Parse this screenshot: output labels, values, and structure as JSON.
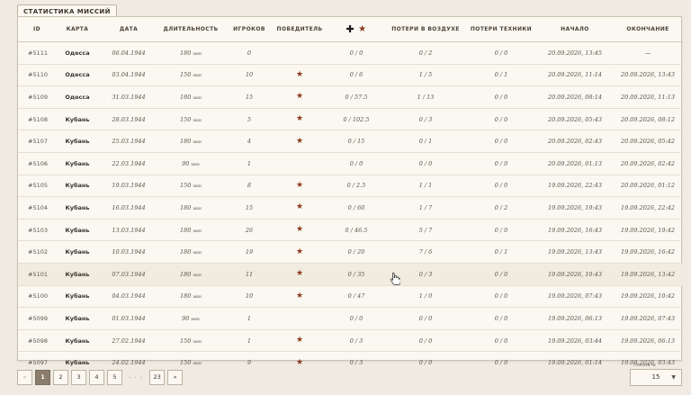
{
  "tab_title": "СТАТИСТИКА МИССИЙ",
  "columns": {
    "id": "ID",
    "map": "КАРТА",
    "date": "ДАТА",
    "duration": "ДЛИТЕЛЬНОСТЬ",
    "players": "ИГРОКОВ",
    "winner": "ПОБЕДИТЕЛЬ",
    "losses": "ПОТЕРИ В ВОЗДУХЕ",
    "tech": "ПОТЕРИ ТЕХНИКИ",
    "start": "НАЧАЛО",
    "end": "ОКОНЧАНИЕ"
  },
  "duration_unit": "мин",
  "rows": [
    {
      "id": "#5111",
      "map": "Одесса",
      "date": "06.04.1944",
      "dur": "180",
      "players": "0",
      "winner": false,
      "score": "0 / 0",
      "air": "0 / 2",
      "tech": "0 / 0",
      "start": "20.09.2026, 13:45",
      "end": "—"
    },
    {
      "id": "#5110",
      "map": "Одесса",
      "date": "03.04.1944",
      "dur": "150",
      "players": "10",
      "winner": true,
      "score": "0 / 6",
      "air": "1 / 5",
      "tech": "0 / 1",
      "start": "20.09.2026, 11:14",
      "end": "20.09.2026, 13:43"
    },
    {
      "id": "#5109",
      "map": "Одесса",
      "date": "31.03.1944",
      "dur": "180",
      "players": "15",
      "winner": true,
      "score": "0 / 57.5",
      "air": "1 / 13",
      "tech": "0 / 0",
      "start": "20.09.2026, 08:14",
      "end": "20.09.2026, 11:13"
    },
    {
      "id": "#5108",
      "map": "Кубань",
      "date": "28.03.1944",
      "dur": "150",
      "players": "5",
      "winner": true,
      "score": "0 / 102.5",
      "air": "0 / 3",
      "tech": "0 / 0",
      "start": "20.09.2026, 05:43",
      "end": "20.09.2026, 08:12"
    },
    {
      "id": "#5107",
      "map": "Кубань",
      "date": "25.03.1944",
      "dur": "180",
      "players": "4",
      "winner": true,
      "score": "0 / 15",
      "air": "0 / 1",
      "tech": "0 / 0",
      "start": "20.09.2026, 02:43",
      "end": "20.09.2026, 05:42"
    },
    {
      "id": "#5106",
      "map": "Кубань",
      "date": "22.03.1944",
      "dur": "90",
      "players": "1",
      "winner": false,
      "score": "0 / 0",
      "air": "0 / 0",
      "tech": "0 / 0",
      "start": "20.09.2026, 01:13",
      "end": "20.09.2026, 02:42"
    },
    {
      "id": "#5105",
      "map": "Кубань",
      "date": "19.03.1944",
      "dur": "150",
      "players": "8",
      "winner": true,
      "score": "0 / 2.5",
      "air": "1 / 1",
      "tech": "0 / 0",
      "start": "19.09.2026, 22:43",
      "end": "20.09.2026, 01:12"
    },
    {
      "id": "#5104",
      "map": "Кубань",
      "date": "16.03.1944",
      "dur": "180",
      "players": "15",
      "winner": true,
      "score": "0 / 60",
      "air": "1 / 7",
      "tech": "0 / 2",
      "start": "19.09.2026, 19:43",
      "end": "19.09.2026, 22:42"
    },
    {
      "id": "#5103",
      "map": "Кубань",
      "date": "13.03.1944",
      "dur": "180",
      "players": "26",
      "winner": true,
      "score": "0 / 46.5",
      "air": "5 / 7",
      "tech": "0 / 0",
      "start": "19.09.2026, 16:43",
      "end": "19.09.2026, 19:42"
    },
    {
      "id": "#5102",
      "map": "Кубань",
      "date": "10.03.1944",
      "dur": "180",
      "players": "19",
      "winner": true,
      "score": "0 / 20",
      "air": "7 / 6",
      "tech": "0 / 1",
      "start": "19.09.2026, 13:43",
      "end": "19.09.2026, 16:42"
    },
    {
      "id": "#5101",
      "map": "Кубань",
      "date": "07.03.1944",
      "dur": "180",
      "players": "11",
      "winner": true,
      "score": "0 / 35",
      "air": "0 / 3",
      "tech": "0 / 0",
      "start": "19.09.2026, 10:43",
      "end": "19.09.2026, 13:42",
      "highlight": true
    },
    {
      "id": "#5100",
      "map": "Кубань",
      "date": "04.03.1944",
      "dur": "180",
      "players": "10",
      "winner": true,
      "score": "0 / 47",
      "air": "1 / 0",
      "tech": "0 / 0",
      "start": "19.09.2026, 07:43",
      "end": "19.09.2026, 10:42"
    },
    {
      "id": "#5099",
      "map": "Кубань",
      "date": "01.03.1944",
      "dur": "90",
      "players": "1",
      "winner": false,
      "score": "0 / 0",
      "air": "0 / 0",
      "tech": "0 / 0",
      "start": "19.09.2026, 06:13",
      "end": "19.09.2026, 07:43"
    },
    {
      "id": "#5098",
      "map": "Кубань",
      "date": "27.02.1944",
      "dur": "150",
      "players": "1",
      "winner": true,
      "score": "0 / 3",
      "air": "0 / 0",
      "tech": "0 / 0",
      "start": "19.09.2026, 03:44",
      "end": "19.09.2026, 06:13"
    },
    {
      "id": "#5097",
      "map": "Кубань",
      "date": "24.02.1944",
      "dur": "150",
      "players": "9",
      "winner": true,
      "score": "0 / 3",
      "air": "0 / 0",
      "tech": "0 / 0",
      "start": "19.09.2026, 01:14",
      "end": "19.09.2026, 03:43"
    }
  ],
  "pagination": {
    "prev": "«",
    "pages": [
      "1",
      "2",
      "3",
      "4",
      "5"
    ],
    "ellipsis": "· · ·",
    "last": "23",
    "next": "»"
  },
  "page_size": {
    "label": "Показать",
    "value": "15",
    "chevron": "▼"
  },
  "colors": {
    "accent": "#8a3a1e",
    "active_page": "#8a7d6b"
  }
}
